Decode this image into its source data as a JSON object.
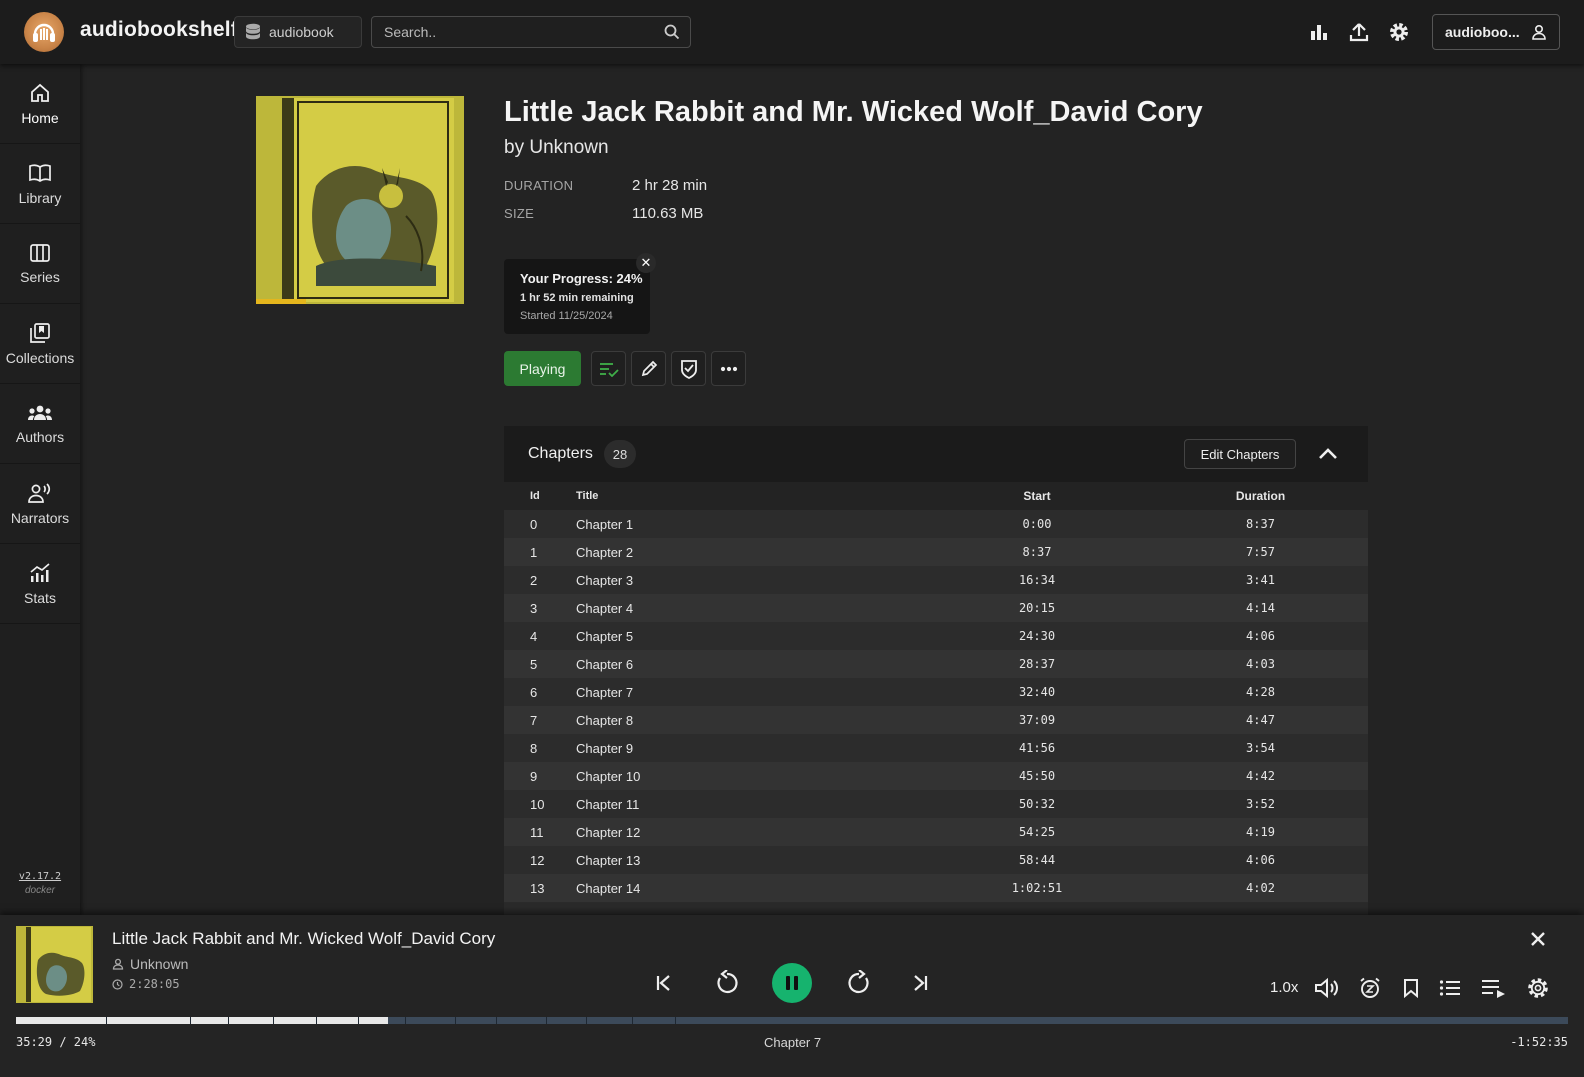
{
  "app": {
    "title": "audiobookshelf"
  },
  "header": {
    "library": "audiobook",
    "search_placeholder": "Search..",
    "user": "audioboo..."
  },
  "sidebar": {
    "items": [
      {
        "label": "Home",
        "icon": "home-icon"
      },
      {
        "label": "Library",
        "icon": "book-open-icon"
      },
      {
        "label": "Series",
        "icon": "columns-icon"
      },
      {
        "label": "Collections",
        "icon": "collections-icon"
      },
      {
        "label": "Authors",
        "icon": "users-icon"
      },
      {
        "label": "Narrators",
        "icon": "narrator-icon"
      },
      {
        "label": "Stats",
        "icon": "stats-icon"
      }
    ],
    "version": "v2.17.2",
    "build": "docker"
  },
  "book": {
    "title": "Little Jack Rabbit and Mr. Wicked Wolf_David Cory",
    "author_prefix": "by",
    "author": "Unknown",
    "duration_label": "Duration",
    "duration": "2 hr 28 min",
    "size_label": "Size",
    "size": "110.63 MB",
    "progress_percent": 24,
    "progress": {
      "title": "Your Progress: 24%",
      "remaining": "1 hr 52 min remaining",
      "started": "Started 11/25/2024"
    },
    "play_label": "Playing"
  },
  "chapters": {
    "title": "Chapters",
    "count": "28",
    "edit_label": "Edit Chapters",
    "columns": [
      "Id",
      "Title",
      "Start",
      "Duration"
    ],
    "rows": [
      [
        "0",
        "Chapter 1",
        "0:00",
        "8:37"
      ],
      [
        "1",
        "Chapter 2",
        "8:37",
        "7:57"
      ],
      [
        "2",
        "Chapter 3",
        "16:34",
        "3:41"
      ],
      [
        "3",
        "Chapter 4",
        "20:15",
        "4:14"
      ],
      [
        "4",
        "Chapter 5",
        "24:30",
        "4:06"
      ],
      [
        "5",
        "Chapter 6",
        "28:37",
        "4:03"
      ],
      [
        "6",
        "Chapter 7",
        "32:40",
        "4:28"
      ],
      [
        "7",
        "Chapter 8",
        "37:09",
        "4:47"
      ],
      [
        "8",
        "Chapter 9",
        "41:56",
        "3:54"
      ],
      [
        "9",
        "Chapter 10",
        "45:50",
        "4:42"
      ],
      [
        "10",
        "Chapter 11",
        "50:32",
        "3:52"
      ],
      [
        "11",
        "Chapter 12",
        "54:25",
        "4:19"
      ],
      [
        "12",
        "Chapter 13",
        "58:44",
        "4:06"
      ],
      [
        "13",
        "Chapter 14",
        "1:02:51",
        "4:02"
      ]
    ]
  },
  "player": {
    "title": "Little Jack Rabbit and Mr. Wicked Wolf_David Cory",
    "author": "Unknown",
    "duration": "2:28:05",
    "speed": "1.0x",
    "current_time": "35:29 / 24%",
    "current_chapter": "Chapter 7",
    "remaining": "-1:52:35",
    "progress_percent": 24
  },
  "colors": {
    "accent_green": "#2c7a32",
    "play_green": "#16b36e",
    "progress_yellow": "#e5b61d"
  }
}
